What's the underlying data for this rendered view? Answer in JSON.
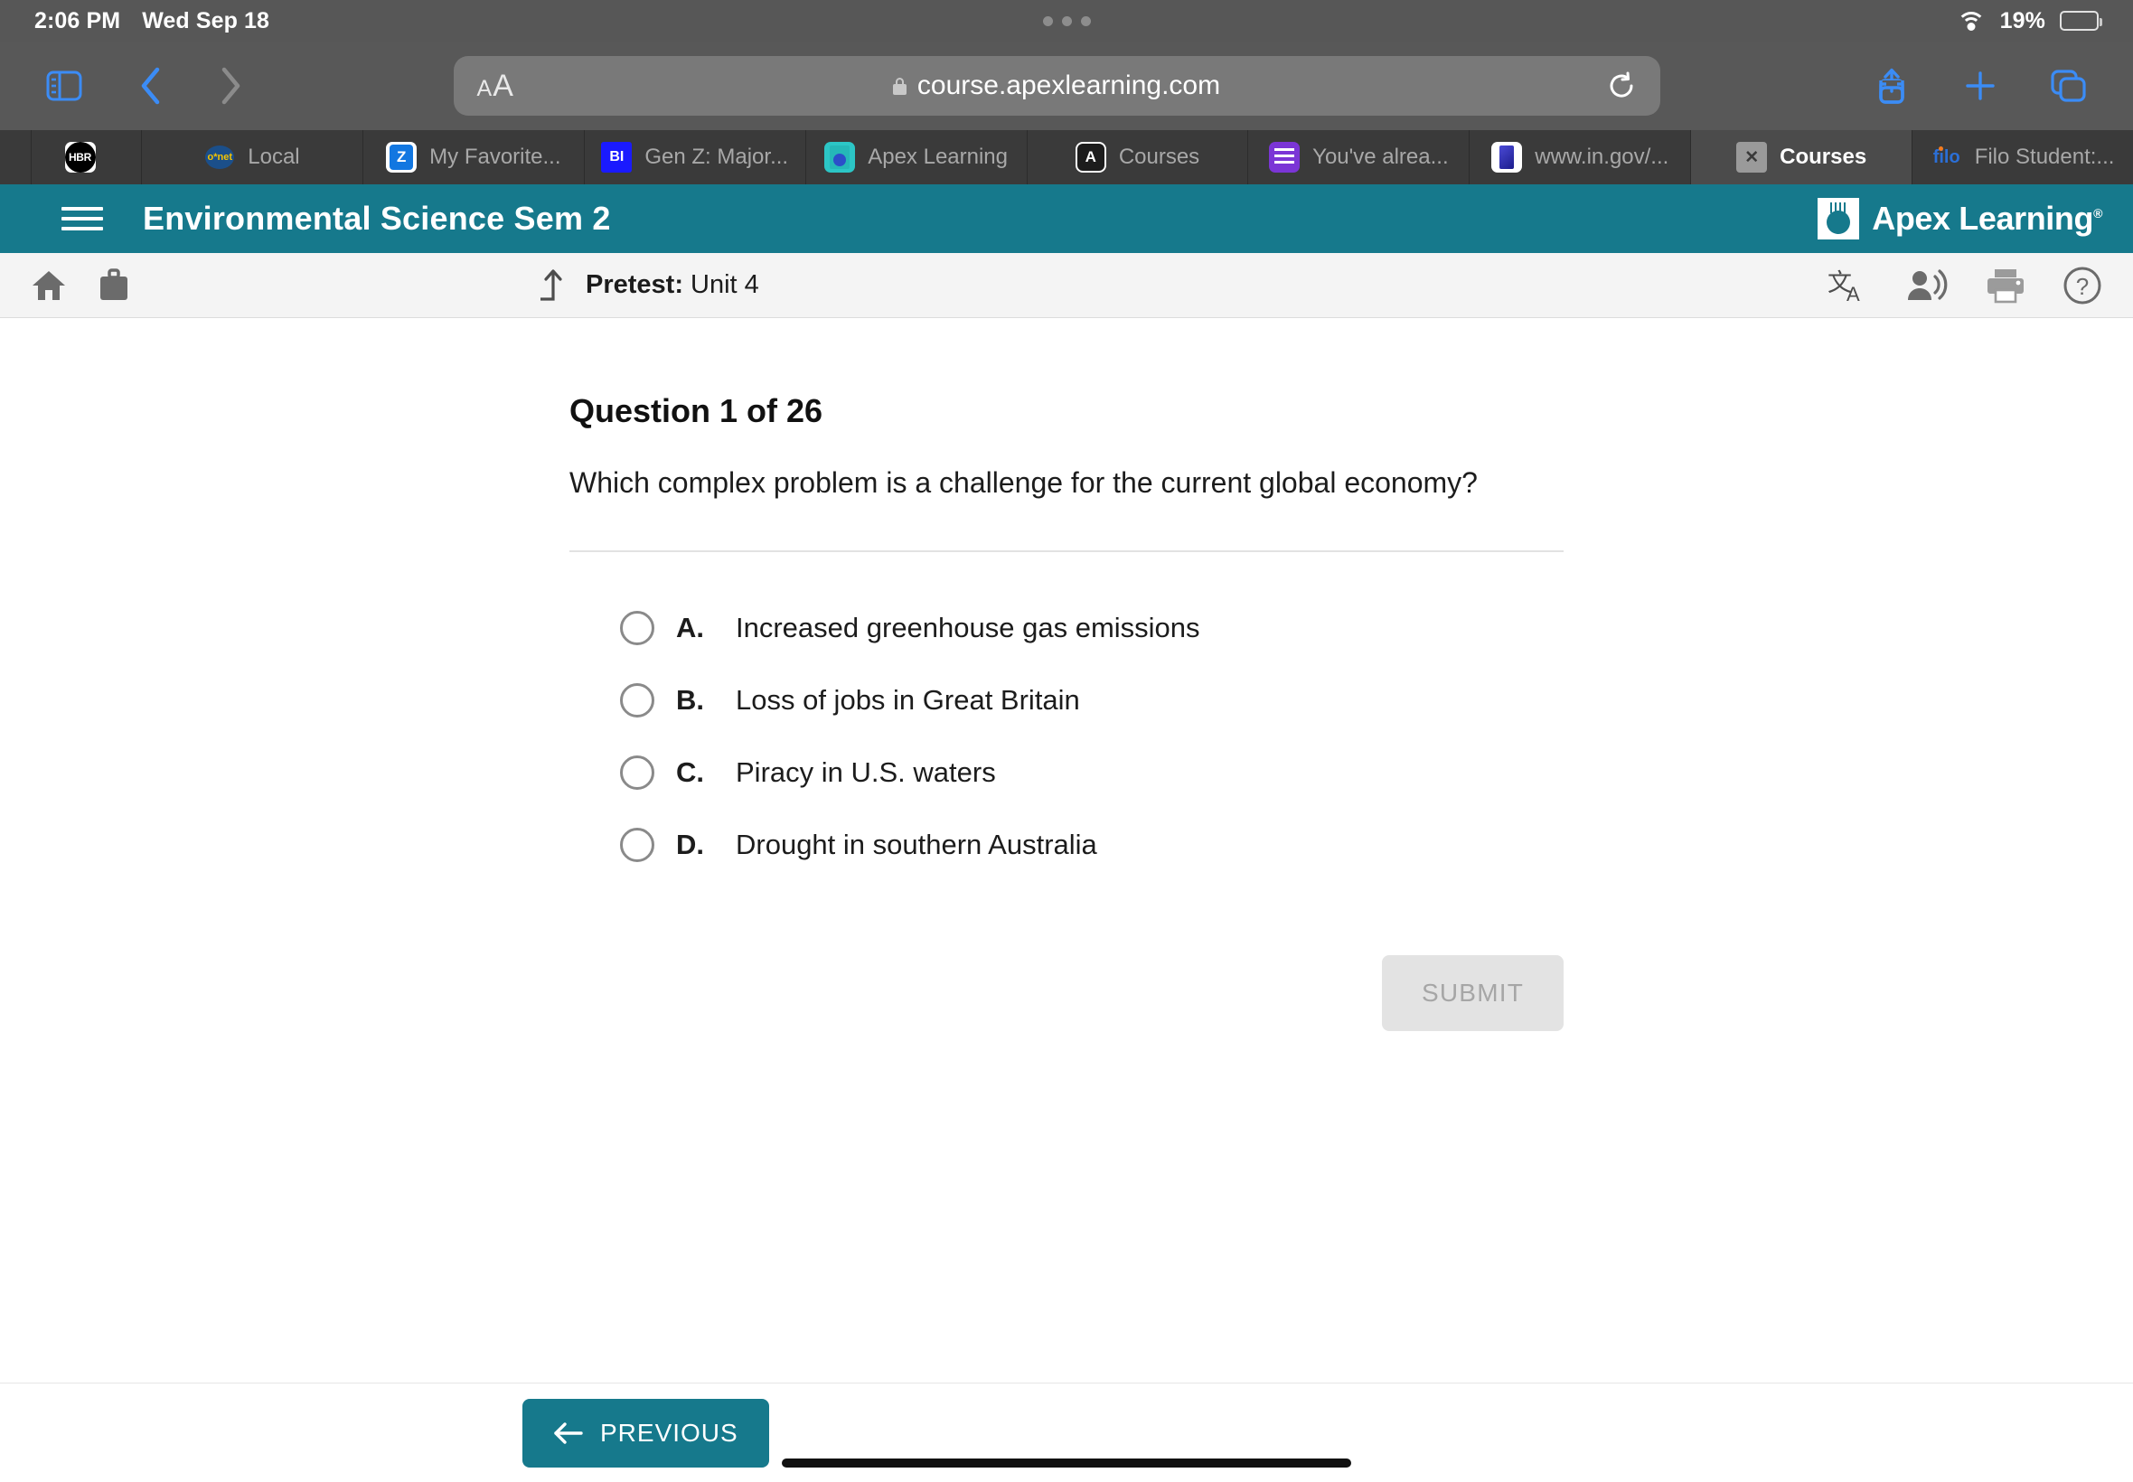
{
  "statusbar": {
    "time": "2:06 PM",
    "date": "Wed Sep 18",
    "battery_percent": "19%",
    "wifi_icon": "wifi-icon",
    "battery_icon": "battery-icon"
  },
  "safari": {
    "sidebar_icon": "sidebar-icon",
    "back_icon": "chevron-left-icon",
    "forward_icon": "chevron-right-icon",
    "text_size_small": "A",
    "text_size_large": "A",
    "url": "course.apexlearning.com",
    "lock_icon": "lock-icon",
    "reload_icon": "reload-icon",
    "share_icon": "share-icon",
    "new_tab_icon": "plus-icon",
    "tabs_overview_icon": "tabs-icon"
  },
  "tabs": [
    {
      "title": "",
      "favicon": "hbr-icon",
      "active": false
    },
    {
      "title": "Local",
      "favicon": "onet-icon",
      "active": false
    },
    {
      "title": "My Favorite...",
      "favicon": "zillow-icon",
      "active": false
    },
    {
      "title": "Gen Z: Major...",
      "favicon": "business-insider-icon",
      "active": false
    },
    {
      "title": "Apex Learning",
      "favicon": "apex-learning-icon",
      "active": false
    },
    {
      "title": "Courses",
      "favicon": "apex-a-icon",
      "active": false
    },
    {
      "title": "You've alrea...",
      "favicon": "google-forms-icon",
      "active": false
    },
    {
      "title": "www.in.gov/...",
      "favicon": "indiana-gov-icon",
      "active": false
    },
    {
      "title": "Courses",
      "favicon": "close-icon",
      "active": true
    },
    {
      "title": "Filo Student:...",
      "favicon": "filo-icon",
      "active": false
    }
  ],
  "header": {
    "menu_icon": "hamburger-menu-icon",
    "course_title": "Environmental Science Sem 2",
    "brand_name": "Apex Learning",
    "brand_trademark": "®",
    "background_color": "#16798c"
  },
  "subbar": {
    "home_icon": "home-icon",
    "briefcase_icon": "briefcase-icon",
    "exit_icon": "exit-up-arrow-icon",
    "breadcrumb_label": "Pretest:",
    "breadcrumb_value": "Unit 4",
    "translate_icon": "translate-icon",
    "read_aloud_icon": "read-aloud-icon",
    "print_icon": "print-icon",
    "help_icon": "help-icon"
  },
  "question": {
    "heading": "Question 1 of 26",
    "prompt": "Which complex problem is a challenge for the current global economy?",
    "options": [
      {
        "letter": "A.",
        "text": "Increased greenhouse gas emissions",
        "selected": false
      },
      {
        "letter": "B.",
        "text": "Loss of jobs in Great Britain",
        "selected": false
      },
      {
        "letter": "C.",
        "text": "Piracy in U.S. waters",
        "selected": false
      },
      {
        "letter": "D.",
        "text": "Drought in southern Australia",
        "selected": false
      }
    ],
    "submit_label": "SUBMIT",
    "submit_enabled": false
  },
  "footer": {
    "previous_label": "PREVIOUS",
    "previous_icon": "arrow-left-icon",
    "accent_color": "#16798c"
  }
}
